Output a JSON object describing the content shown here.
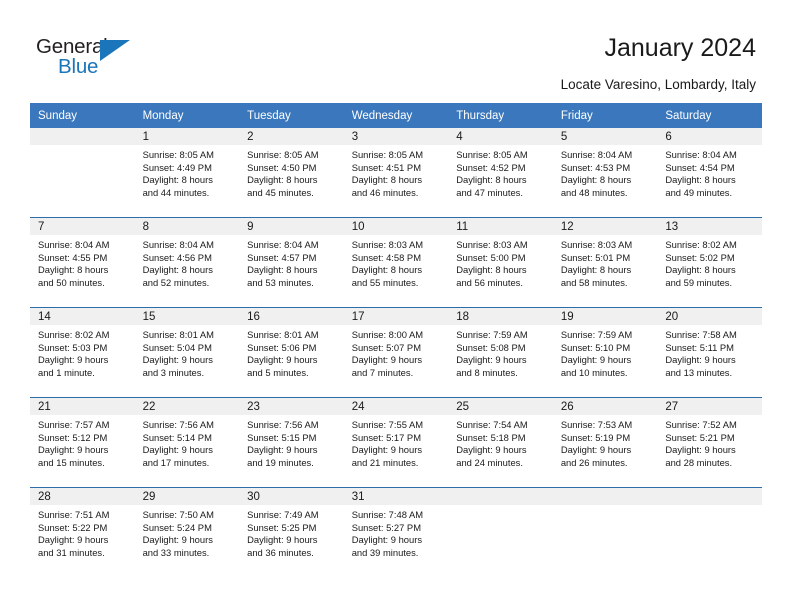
{
  "logo": {
    "word_top": "General",
    "word_bottom": "Blue",
    "accent_color": "#1b75bb"
  },
  "header": {
    "title": "January 2024",
    "subtitle": "Locate Varesino, Lombardy, Italy"
  },
  "theme": {
    "header_blue": "#3a77bd",
    "row_divider_blue": "#2e6da8",
    "daynum_band_gray": "#f0f0f0"
  },
  "calendar": {
    "weekday_headers": [
      "Sunday",
      "Monday",
      "Tuesday",
      "Wednesday",
      "Thursday",
      "Friday",
      "Saturday"
    ],
    "weeks": [
      [
        {
          "day": "",
          "sunrise": "",
          "sunset": "",
          "daylight_line1": "",
          "daylight_line2": "",
          "empty": true
        },
        {
          "day": "1",
          "sunrise": "Sunrise: 8:05 AM",
          "sunset": "Sunset: 4:49 PM",
          "daylight_line1": "Daylight: 8 hours",
          "daylight_line2": "and 44 minutes.",
          "empty": false
        },
        {
          "day": "2",
          "sunrise": "Sunrise: 8:05 AM",
          "sunset": "Sunset: 4:50 PM",
          "daylight_line1": "Daylight: 8 hours",
          "daylight_line2": "and 45 minutes.",
          "empty": false
        },
        {
          "day": "3",
          "sunrise": "Sunrise: 8:05 AM",
          "sunset": "Sunset: 4:51 PM",
          "daylight_line1": "Daylight: 8 hours",
          "daylight_line2": "and 46 minutes.",
          "empty": false
        },
        {
          "day": "4",
          "sunrise": "Sunrise: 8:05 AM",
          "sunset": "Sunset: 4:52 PM",
          "daylight_line1": "Daylight: 8 hours",
          "daylight_line2": "and 47 minutes.",
          "empty": false
        },
        {
          "day": "5",
          "sunrise": "Sunrise: 8:04 AM",
          "sunset": "Sunset: 4:53 PM",
          "daylight_line1": "Daylight: 8 hours",
          "daylight_line2": "and 48 minutes.",
          "empty": false
        },
        {
          "day": "6",
          "sunrise": "Sunrise: 8:04 AM",
          "sunset": "Sunset: 4:54 PM",
          "daylight_line1": "Daylight: 8 hours",
          "daylight_line2": "and 49 minutes.",
          "empty": false
        }
      ],
      [
        {
          "day": "7",
          "sunrise": "Sunrise: 8:04 AM",
          "sunset": "Sunset: 4:55 PM",
          "daylight_line1": "Daylight: 8 hours",
          "daylight_line2": "and 50 minutes.",
          "empty": false
        },
        {
          "day": "8",
          "sunrise": "Sunrise: 8:04 AM",
          "sunset": "Sunset: 4:56 PM",
          "daylight_line1": "Daylight: 8 hours",
          "daylight_line2": "and 52 minutes.",
          "empty": false
        },
        {
          "day": "9",
          "sunrise": "Sunrise: 8:04 AM",
          "sunset": "Sunset: 4:57 PM",
          "daylight_line1": "Daylight: 8 hours",
          "daylight_line2": "and 53 minutes.",
          "empty": false
        },
        {
          "day": "10",
          "sunrise": "Sunrise: 8:03 AM",
          "sunset": "Sunset: 4:58 PM",
          "daylight_line1": "Daylight: 8 hours",
          "daylight_line2": "and 55 minutes.",
          "empty": false
        },
        {
          "day": "11",
          "sunrise": "Sunrise: 8:03 AM",
          "sunset": "Sunset: 5:00 PM",
          "daylight_line1": "Daylight: 8 hours",
          "daylight_line2": "and 56 minutes.",
          "empty": false
        },
        {
          "day": "12",
          "sunrise": "Sunrise: 8:03 AM",
          "sunset": "Sunset: 5:01 PM",
          "daylight_line1": "Daylight: 8 hours",
          "daylight_line2": "and 58 minutes.",
          "empty": false
        },
        {
          "day": "13",
          "sunrise": "Sunrise: 8:02 AM",
          "sunset": "Sunset: 5:02 PM",
          "daylight_line1": "Daylight: 8 hours",
          "daylight_line2": "and 59 minutes.",
          "empty": false
        }
      ],
      [
        {
          "day": "14",
          "sunrise": "Sunrise: 8:02 AM",
          "sunset": "Sunset: 5:03 PM",
          "daylight_line1": "Daylight: 9 hours",
          "daylight_line2": "and 1 minute.",
          "empty": false
        },
        {
          "day": "15",
          "sunrise": "Sunrise: 8:01 AM",
          "sunset": "Sunset: 5:04 PM",
          "daylight_line1": "Daylight: 9 hours",
          "daylight_line2": "and 3 minutes.",
          "empty": false
        },
        {
          "day": "16",
          "sunrise": "Sunrise: 8:01 AM",
          "sunset": "Sunset: 5:06 PM",
          "daylight_line1": "Daylight: 9 hours",
          "daylight_line2": "and 5 minutes.",
          "empty": false
        },
        {
          "day": "17",
          "sunrise": "Sunrise: 8:00 AM",
          "sunset": "Sunset: 5:07 PM",
          "daylight_line1": "Daylight: 9 hours",
          "daylight_line2": "and 7 minutes.",
          "empty": false
        },
        {
          "day": "18",
          "sunrise": "Sunrise: 7:59 AM",
          "sunset": "Sunset: 5:08 PM",
          "daylight_line1": "Daylight: 9 hours",
          "daylight_line2": "and 8 minutes.",
          "empty": false
        },
        {
          "day": "19",
          "sunrise": "Sunrise: 7:59 AM",
          "sunset": "Sunset: 5:10 PM",
          "daylight_line1": "Daylight: 9 hours",
          "daylight_line2": "and 10 minutes.",
          "empty": false
        },
        {
          "day": "20",
          "sunrise": "Sunrise: 7:58 AM",
          "sunset": "Sunset: 5:11 PM",
          "daylight_line1": "Daylight: 9 hours",
          "daylight_line2": "and 13 minutes.",
          "empty": false
        }
      ],
      [
        {
          "day": "21",
          "sunrise": "Sunrise: 7:57 AM",
          "sunset": "Sunset: 5:12 PM",
          "daylight_line1": "Daylight: 9 hours",
          "daylight_line2": "and 15 minutes.",
          "empty": false
        },
        {
          "day": "22",
          "sunrise": "Sunrise: 7:56 AM",
          "sunset": "Sunset: 5:14 PM",
          "daylight_line1": "Daylight: 9 hours",
          "daylight_line2": "and 17 minutes.",
          "empty": false
        },
        {
          "day": "23",
          "sunrise": "Sunrise: 7:56 AM",
          "sunset": "Sunset: 5:15 PM",
          "daylight_line1": "Daylight: 9 hours",
          "daylight_line2": "and 19 minutes.",
          "empty": false
        },
        {
          "day": "24",
          "sunrise": "Sunrise: 7:55 AM",
          "sunset": "Sunset: 5:17 PM",
          "daylight_line1": "Daylight: 9 hours",
          "daylight_line2": "and 21 minutes.",
          "empty": false
        },
        {
          "day": "25",
          "sunrise": "Sunrise: 7:54 AM",
          "sunset": "Sunset: 5:18 PM",
          "daylight_line1": "Daylight: 9 hours",
          "daylight_line2": "and 24 minutes.",
          "empty": false
        },
        {
          "day": "26",
          "sunrise": "Sunrise: 7:53 AM",
          "sunset": "Sunset: 5:19 PM",
          "daylight_line1": "Daylight: 9 hours",
          "daylight_line2": "and 26 minutes.",
          "empty": false
        },
        {
          "day": "27",
          "sunrise": "Sunrise: 7:52 AM",
          "sunset": "Sunset: 5:21 PM",
          "daylight_line1": "Daylight: 9 hours",
          "daylight_line2": "and 28 minutes.",
          "empty": false
        }
      ],
      [
        {
          "day": "28",
          "sunrise": "Sunrise: 7:51 AM",
          "sunset": "Sunset: 5:22 PM",
          "daylight_line1": "Daylight: 9 hours",
          "daylight_line2": "and 31 minutes.",
          "empty": false
        },
        {
          "day": "29",
          "sunrise": "Sunrise: 7:50 AM",
          "sunset": "Sunset: 5:24 PM",
          "daylight_line1": "Daylight: 9 hours",
          "daylight_line2": "and 33 minutes.",
          "empty": false
        },
        {
          "day": "30",
          "sunrise": "Sunrise: 7:49 AM",
          "sunset": "Sunset: 5:25 PM",
          "daylight_line1": "Daylight: 9 hours",
          "daylight_line2": "and 36 minutes.",
          "empty": false
        },
        {
          "day": "31",
          "sunrise": "Sunrise: 7:48 AM",
          "sunset": "Sunset: 5:27 PM",
          "daylight_line1": "Daylight: 9 hours",
          "daylight_line2": "and 39 minutes.",
          "empty": false
        },
        {
          "day": "",
          "sunrise": "",
          "sunset": "",
          "daylight_line1": "",
          "daylight_line2": "",
          "empty": true
        },
        {
          "day": "",
          "sunrise": "",
          "sunset": "",
          "daylight_line1": "",
          "daylight_line2": "",
          "empty": true
        },
        {
          "day": "",
          "sunrise": "",
          "sunset": "",
          "daylight_line1": "",
          "daylight_line2": "",
          "empty": true
        }
      ]
    ]
  }
}
